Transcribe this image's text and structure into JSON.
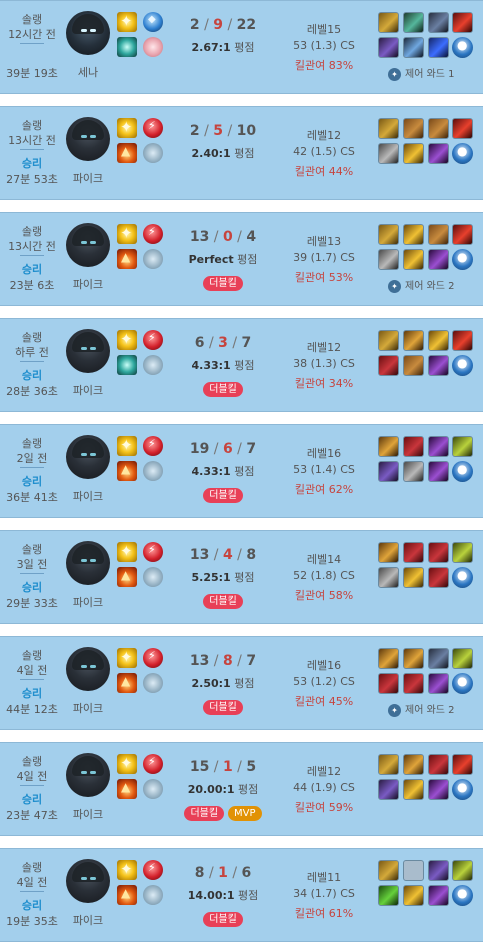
{
  "labels": {
    "kda_suffix": "평점",
    "level_prefix": "레벨",
    "cs_suffix": "CS",
    "kp_prefix": "킬관여"
  },
  "matches": [
    {
      "type": "솔랭",
      "ago": "12시간 전",
      "result": "",
      "duration": "39분 19초",
      "champion": "세나",
      "portrait": "senna",
      "spells": [
        "flash",
        "exhaust"
      ],
      "runes": [
        "rune-blue",
        "rune-pink"
      ],
      "kills": "2",
      "deaths": "9",
      "assists": "22",
      "ratio": "2.67:1",
      "badges": [],
      "level": "15",
      "cs": "53 (1.3)",
      "kp": "83%",
      "items": [
        0,
        1,
        2,
        3,
        4,
        5,
        6,
        "ward"
      ],
      "ward_text": "제어 와드 1"
    },
    {
      "type": "솔랭",
      "ago": "13시간 전",
      "result": "승리",
      "duration": "27분 53초",
      "champion": "파이크",
      "portrait": "pyke",
      "spells": [
        "flash",
        "ignite"
      ],
      "runes": [
        "rune-red",
        "rune-sec"
      ],
      "kills": "2",
      "deaths": "5",
      "assists": "10",
      "ratio": "2.40:1",
      "badges": [],
      "level": "12",
      "cs": "42 (1.5)",
      "kp": "44%",
      "items": [
        0,
        7,
        7,
        3,
        8,
        9,
        10,
        "ward"
      ],
      "ward_text": ""
    },
    {
      "type": "솔랭",
      "ago": "13시간 전",
      "result": "승리",
      "duration": "23분 6초",
      "champion": "파이크",
      "portrait": "pyke",
      "spells": [
        "flash",
        "ignite"
      ],
      "runes": [
        "rune-red",
        "rune-sec"
      ],
      "kills": "13",
      "deaths": "0",
      "assists": "4",
      "ratio": "Perfect",
      "badges": [
        "더블킬"
      ],
      "level": "13",
      "cs": "39 (1.7)",
      "kp": "53%",
      "items": [
        0,
        9,
        7,
        3,
        8,
        9,
        10,
        "ward"
      ],
      "ward_text": "제어 와드 2"
    },
    {
      "type": "솔랭",
      "ago": "하루 전",
      "result": "승리",
      "duration": "28분 36초",
      "champion": "파이크",
      "portrait": "pyke",
      "spells": [
        "flash",
        "exhaust"
      ],
      "runes": [
        "rune-red",
        "rune-sec"
      ],
      "kills": "6",
      "deaths": "3",
      "assists": "7",
      "ratio": "4.33:1",
      "badges": [
        "더블킬"
      ],
      "level": "12",
      "cs": "38 (1.3)",
      "kp": "34%",
      "items": [
        0,
        14,
        9,
        3,
        11,
        7,
        10,
        "ward"
      ],
      "ward_text": ""
    },
    {
      "type": "솔랭",
      "ago": "2일 전",
      "result": "승리",
      "duration": "36분 41초",
      "champion": "파이크",
      "portrait": "pyke",
      "spells": [
        "flash",
        "ignite"
      ],
      "runes": [
        "rune-red",
        "rune-sec"
      ],
      "kills": "19",
      "deaths": "6",
      "assists": "7",
      "ratio": "4.33:1",
      "badges": [
        "더블킬"
      ],
      "level": "16",
      "cs": "53 (1.4)",
      "kp": "62%",
      "items": [
        14,
        11,
        10,
        12,
        4,
        8,
        10,
        "ward"
      ],
      "ward_text": ""
    },
    {
      "type": "솔랭",
      "ago": "3일 전",
      "result": "승리",
      "duration": "29분 33초",
      "champion": "파이크",
      "portrait": "pyke",
      "spells": [
        "flash",
        "ignite"
      ],
      "runes": [
        "rune-red",
        "rune-sec"
      ],
      "kills": "13",
      "deaths": "4",
      "assists": "8",
      "ratio": "5.25:1",
      "badges": [
        "더블킬"
      ],
      "level": "14",
      "cs": "52 (1.8)",
      "kp": "58%",
      "items": [
        14,
        11,
        11,
        12,
        8,
        9,
        11,
        "ward"
      ],
      "ward_text": ""
    },
    {
      "type": "솔랭",
      "ago": "4일 전",
      "result": "승리",
      "duration": "44분 12초",
      "champion": "파이크",
      "portrait": "pyke",
      "spells": [
        "flash",
        "ignite"
      ],
      "runes": [
        "rune-red",
        "rune-sec"
      ],
      "kills": "13",
      "deaths": "8",
      "assists": "7",
      "ratio": "2.50:1",
      "badges": [
        "더블킬"
      ],
      "level": "16",
      "cs": "53 (1.2)",
      "kp": "45%",
      "items": [
        14,
        14,
        2,
        12,
        11,
        11,
        10,
        "ward"
      ],
      "ward_text": "제어 와드 2"
    },
    {
      "type": "솔랭",
      "ago": "4일 전",
      "result": "승리",
      "duration": "23분 47초",
      "champion": "파이크",
      "portrait": "pyke",
      "spells": [
        "flash",
        "ignite"
      ],
      "runes": [
        "rune-red",
        "rune-sec"
      ],
      "kills": "15",
      "deaths": "1",
      "assists": "5",
      "ratio": "20.00:1",
      "badges": [
        "더블킬",
        "MVP"
      ],
      "level": "12",
      "cs": "44 (1.9)",
      "kp": "59%",
      "items": [
        0,
        14,
        11,
        3,
        4,
        9,
        10,
        "ward"
      ],
      "ward_text": ""
    },
    {
      "type": "솔랭",
      "ago": "4일 전",
      "result": "승리",
      "duration": "19분 35초",
      "champion": "파이크",
      "portrait": "pyke",
      "spells": [
        "flash",
        "ignite"
      ],
      "runes": [
        "rune-red",
        "rune-sec"
      ],
      "kills": "8",
      "deaths": "1",
      "assists": "6",
      "ratio": "14.00:1",
      "badges": [
        "더블킬"
      ],
      "level": "11",
      "cs": "34 (1.7)",
      "kp": "61%",
      "items": [
        0,
        "empty",
        4,
        12,
        13,
        9,
        10,
        "ward"
      ],
      "ward_text": ""
    }
  ]
}
